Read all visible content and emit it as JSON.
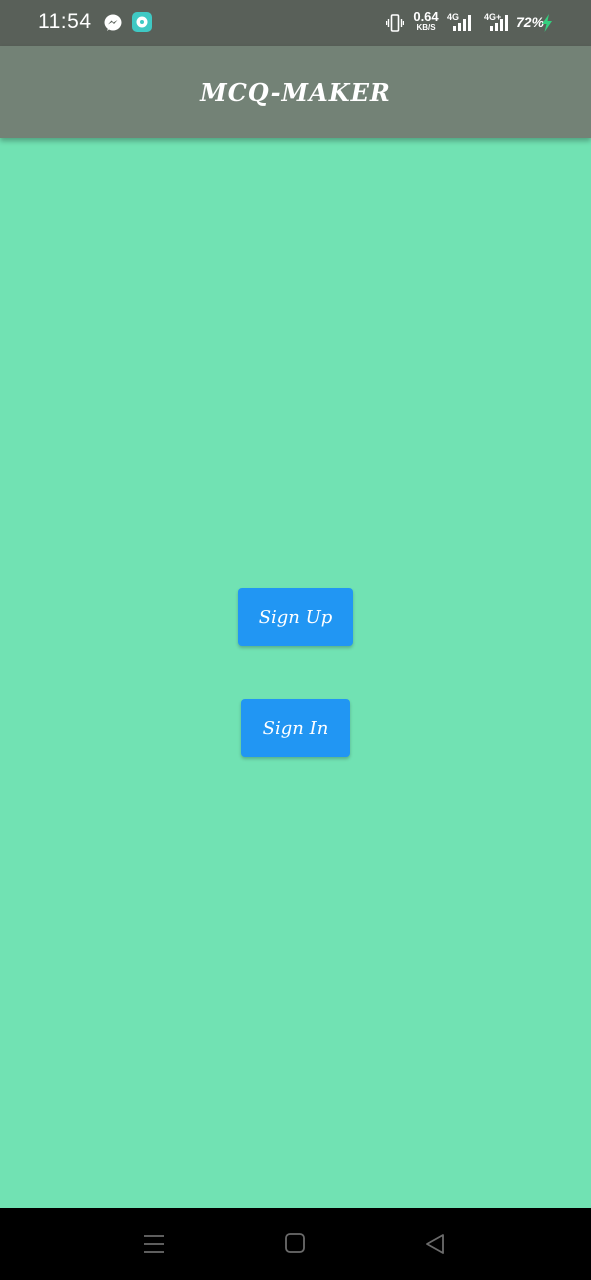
{
  "status_bar": {
    "time": "11:54",
    "notification_icons": [
      "messenger-icon",
      "chat-app-icon"
    ],
    "net_speed_value": "0.64",
    "net_speed_unit": "KB/S",
    "sim1_type": "4G",
    "sim2_type": "4G+",
    "battery_percent": "72%",
    "charging": true
  },
  "app_bar": {
    "title": "MCQ-MAKER"
  },
  "main": {
    "sign_up_label": "Sign Up",
    "sign_in_label": "Sign In"
  },
  "nav_bar": {
    "icons": [
      "menu-icon",
      "home-icon",
      "back-icon"
    ]
  },
  "colors": {
    "status_bar_bg": "#596059",
    "app_bar_bg": "#738276",
    "content_bg": "#71e2b3",
    "button_bg": "#2196f3",
    "button_text": "#ffffff",
    "nav_bar_bg": "#000000",
    "charging_bolt": "#35d07f"
  }
}
